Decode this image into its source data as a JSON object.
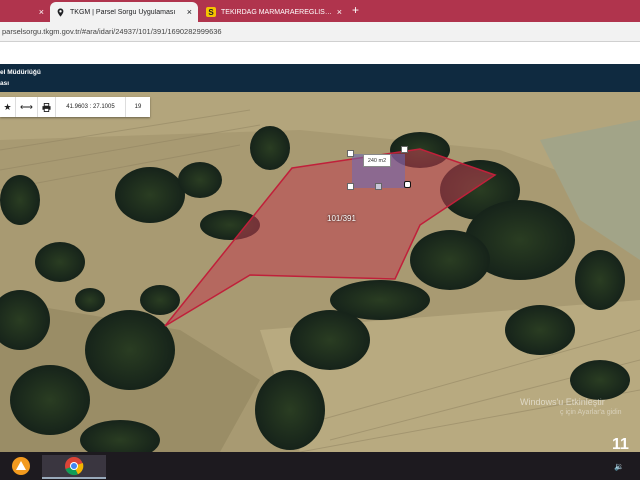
{
  "browser": {
    "tabs": [
      {
        "label": "",
        "active": false,
        "close_icon": "×"
      },
      {
        "label": "TKGM | Parsel Sorgu Uygulaması",
        "active": true,
        "close_icon": "×"
      },
      {
        "label": "TEKİRDAĞ MARMARAEREĞLİSİ Ç",
        "active": false,
        "close_icon": "×"
      }
    ],
    "new_tab_icon": "+",
    "url": "parselsorgu.tkgm.gov.tr/#ara/idari/24937/101/391/1690282999636"
  },
  "app_header": {
    "line1": "el Müdürlüğü",
    "line2": "ası"
  },
  "toolbar": {
    "star_icon": "★",
    "measure_icon": "⟷",
    "print_icon": "🖶",
    "coordinates": "41.9603 : 27.1005",
    "zoom": "19"
  },
  "map": {
    "parcel_label": "101/391",
    "area_label": "240 m2",
    "colors": {
      "parcel_stroke": "#c0203a",
      "parcel_fill": "#c04050"
    }
  },
  "watermark": {
    "line1": "Windows'u Etkinleştir",
    "line2": "ç için Ayarlar'a gidin"
  },
  "taskbar": {
    "clock_partial": "11",
    "tray_icon": "🔉"
  }
}
